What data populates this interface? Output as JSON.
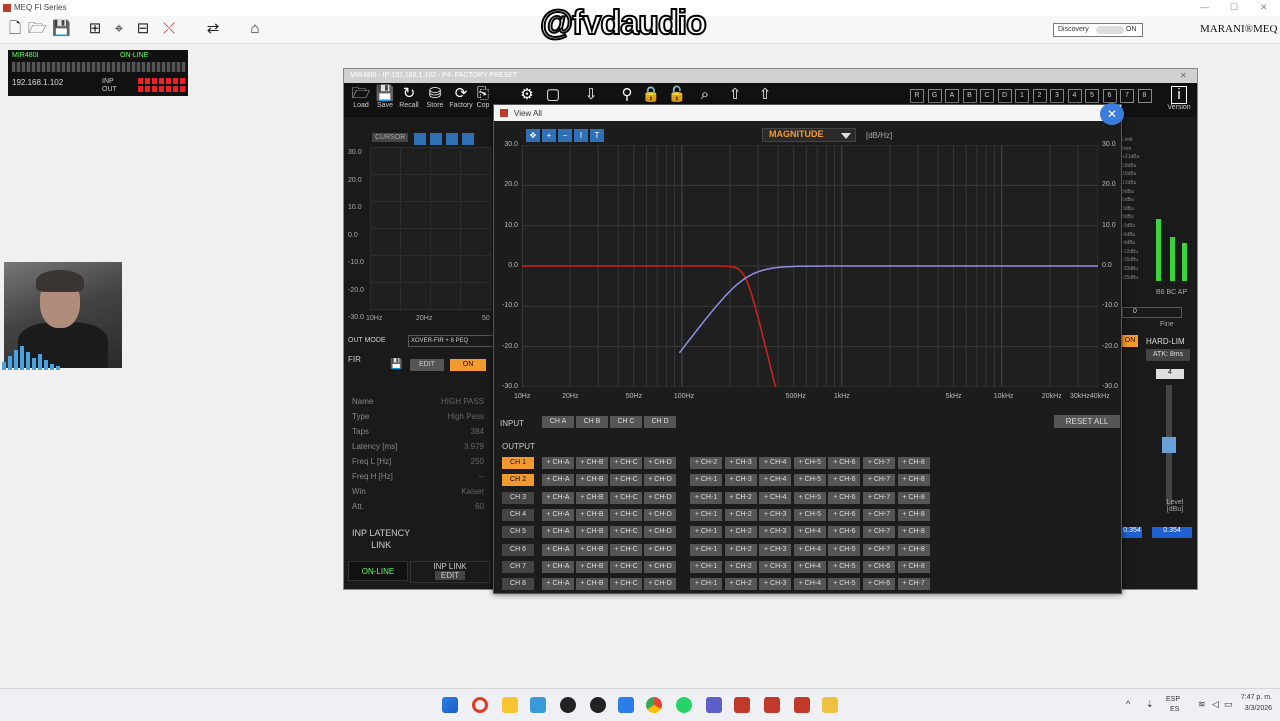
{
  "app": {
    "title": "MEQ FI Series",
    "brand": "MARANI®MEQ",
    "watermark": "@fvdaudio"
  },
  "discovery": {
    "label": "Discovery",
    "state": "ON"
  },
  "device": {
    "name": "MIR480I",
    "status": "ON-LINE",
    "ip": "192.168.1.102",
    "inp": "INP",
    "out": "OUT"
  },
  "mir_window": {
    "title": "MIR480I - IP:192.168.1.102 - P4: FACTORY PRESET",
    "toolbar": [
      {
        "label": "Load",
        "icon": "folder-icon"
      },
      {
        "label": "Save",
        "icon": "save-icon"
      },
      {
        "label": "Recall",
        "icon": "recall-icon"
      },
      {
        "label": "Store",
        "icon": "store-icon"
      },
      {
        "label": "Factory",
        "icon": "factory-icon"
      },
      {
        "label": "Cop",
        "icon": "copy-icon"
      }
    ],
    "version_label": "Version",
    "preset_buttons": [
      "R",
      "G",
      "A",
      "B",
      "C",
      "D",
      "1",
      "2",
      "3",
      "4",
      "5",
      "6",
      "7",
      "8"
    ],
    "cursor_label": "CURSOR",
    "left_graph": {
      "yticks": [
        "30.0",
        "20.0",
        "10.0",
        "0.0",
        "-10.0",
        "-20.0",
        "-30.0"
      ],
      "xticks": [
        "10Hz",
        "20Hz",
        "50"
      ]
    },
    "out_mode": {
      "label": "OUT MODE",
      "value": "XOVER-FIR + 8 PEQ"
    },
    "fir": {
      "label": "FIR",
      "edit": "EDIT",
      "on": "ON"
    },
    "params": [
      {
        "name": "Name",
        "value": "HIGH PASS"
      },
      {
        "name": "Type",
        "value": "High Pass"
      },
      {
        "name": "Taps",
        "value": "384"
      },
      {
        "name": "Latency [ms]",
        "value": "3.979"
      },
      {
        "name": "Freq L [Hz]",
        "value": "250"
      },
      {
        "name": "Freq H [Hz]",
        "value": "--"
      },
      {
        "name": "Win",
        "value": "Kaiser"
      },
      {
        "name": "Att.",
        "value": "60"
      }
    ],
    "inp_latency": "INP LATENCY",
    "link": "LINK",
    "online": "ON-LINE",
    "inp_link": "INP LINK",
    "inp_link_edit": "EDIT",
    "right": {
      "meter_labels": [
        "Limit",
        "0vm",
        "+21dBu",
        "18dBu",
        "15dBu",
        "12dBu",
        "9dBu",
        "6dBu",
        "3dBu",
        "0dBu",
        "-3dBu",
        "-6dBu",
        "-9dBu",
        "-12dBu",
        "-15dBu",
        "-20dBu",
        "-25dBu"
      ],
      "meter_foot": "B6 BC AP",
      "fine_value": "0",
      "fine_label": "Fine",
      "hard_lim": "HARD-LIM",
      "atk": "ATK: 8ms",
      "level_value": "4",
      "level_label": "Level [dBu]",
      "on": "ON",
      "val_a": "0.354",
      "val_b": "0.354"
    }
  },
  "view_all": {
    "title": "View All",
    "mode": "MAGNITUDE",
    "unit": "[dB/Hz]",
    "yticks": [
      "30.0",
      "20.0",
      "10.0",
      "0.0",
      "-10.0",
      "-20.0",
      "-30.0"
    ],
    "xticks": [
      "10Hz",
      "20Hz",
      "50Hz",
      "100Hz",
      "500Hz",
      "1kHz",
      "5kHz",
      "10kHz",
      "20kHz",
      "30kHz40kHz"
    ],
    "input_label": "INPUT",
    "inputs": [
      "CH A",
      "CH B",
      "CH C",
      "CH D"
    ],
    "reset_all": "RESET ALL",
    "output_label": "OUTPUT",
    "outputs": [
      {
        "ch": "CH 1",
        "active": true,
        "links": [
          "+ CH-2",
          "+ CH-3",
          "+ CH-4",
          "+ CH-5",
          "+ CH-6",
          "+ CH-7",
          "+ CH-8"
        ]
      },
      {
        "ch": "CH 2",
        "active": true,
        "links": [
          "+ CH-1",
          "+ CH-3",
          "+ CH-4",
          "+ CH-5",
          "+ CH-6",
          "+ CH-7",
          "+ CH-8"
        ]
      },
      {
        "ch": "CH 3",
        "active": false,
        "links": [
          "+ CH-1",
          "+ CH-2",
          "+ CH-4",
          "+ CH-5",
          "+ CH-6",
          "+ CH-7",
          "+ CH-8"
        ]
      },
      {
        "ch": "CH 4",
        "active": false,
        "links": [
          "+ CH-1",
          "+ CH-2",
          "+ CH-3",
          "+ CH-5",
          "+ CH-6",
          "+ CH-7",
          "+ CH-8"
        ]
      },
      {
        "ch": "CH 5",
        "active": false,
        "links": [
          "+ CH-1",
          "+ CH-2",
          "+ CH-3",
          "+ CH-4",
          "+ CH-6",
          "+ CH-7",
          "+ CH-8"
        ]
      },
      {
        "ch": "CH 6",
        "active": false,
        "links": [
          "+ CH-1",
          "+ CH-2",
          "+ CH-3",
          "+ CH-4",
          "+ CH-5",
          "+ CH-7",
          "+ CH-8"
        ]
      },
      {
        "ch": "CH 7",
        "active": false,
        "links": [
          "+ CH-1",
          "+ CH-2",
          "+ CH-3",
          "+ CH-4",
          "+ CH-5",
          "+ CH-6",
          "+ CH-8"
        ]
      },
      {
        "ch": "CH 8",
        "active": false,
        "links": [
          "+ CH-1",
          "+ CH-2",
          "+ CH-3",
          "+ CH-4",
          "+ CH-5",
          "+ CH-6",
          "+ CH-7"
        ]
      }
    ],
    "input_links": [
      "+ CH-A",
      "+ CH-B",
      "+ CH-C",
      "+ CH-D"
    ],
    "colors": {
      "accent": "#f29a2e",
      "lowpass": "#d42020",
      "highpass": "#8f8fe6",
      "zoom": "#2f6fb5"
    }
  },
  "taskbar": {
    "lang": "ESP",
    "lang2": "ES",
    "time": "7:47 p. m.",
    "date": "3/3/2026"
  }
}
